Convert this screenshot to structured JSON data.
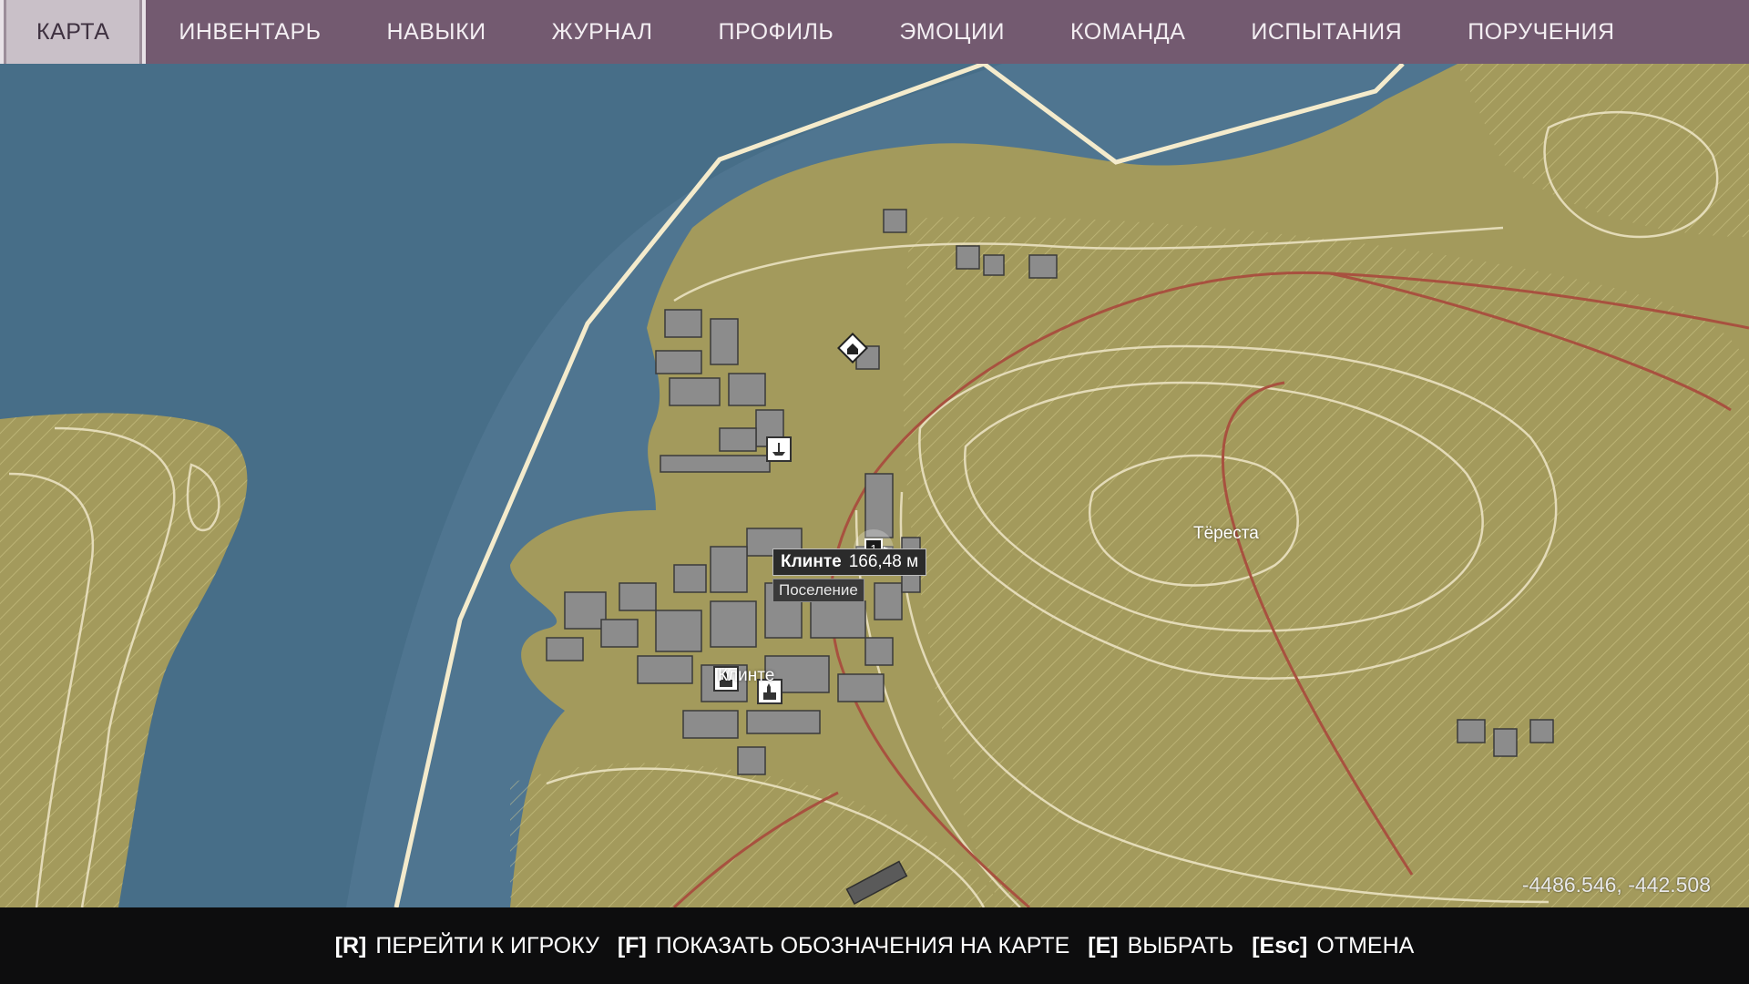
{
  "nav": {
    "items": [
      {
        "label": "КАРТА",
        "active": true
      },
      {
        "label": "ИНВЕНТАРЬ"
      },
      {
        "label": "НАВЫКИ"
      },
      {
        "label": "ЖУРНАЛ"
      },
      {
        "label": "ПРОФИЛЬ"
      },
      {
        "label": "ЭМОЦИИ"
      },
      {
        "label": "КОМАНДА"
      },
      {
        "label": "ИСПЫТАНИЯ"
      },
      {
        "label": "ПОРУЧЕНИЯ"
      }
    ]
  },
  "map": {
    "labels": {
      "town": "Клинте",
      "region": "Тёреста"
    },
    "tooltip": {
      "name": "Клинте",
      "distance": "166,48 м",
      "type": "Поселение"
    },
    "coordinates": "-4486.546, -442.508",
    "icons": [
      "home-icon",
      "harbor-icon",
      "player-marker-icon",
      "church-icon",
      "church-icon"
    ],
    "colors": {
      "water": "#4f7590",
      "deep_water": "#456b85",
      "land": "#a39a5c",
      "border": "#f4ebcc",
      "road": "#a8513f",
      "nav_bg": "#735a70"
    }
  },
  "bottom": {
    "hints": [
      {
        "key": "[R]",
        "label": "ПЕРЕЙТИ К ИГРОКУ"
      },
      {
        "key": "[F]",
        "label": "ПОКАЗАТЬ ОБОЗНАЧЕНИЯ НА КАРТЕ"
      },
      {
        "key": "[E]",
        "label": "ВЫБРАТЬ"
      },
      {
        "key": "[Esc]",
        "label": "ОТМЕНА"
      }
    ]
  }
}
